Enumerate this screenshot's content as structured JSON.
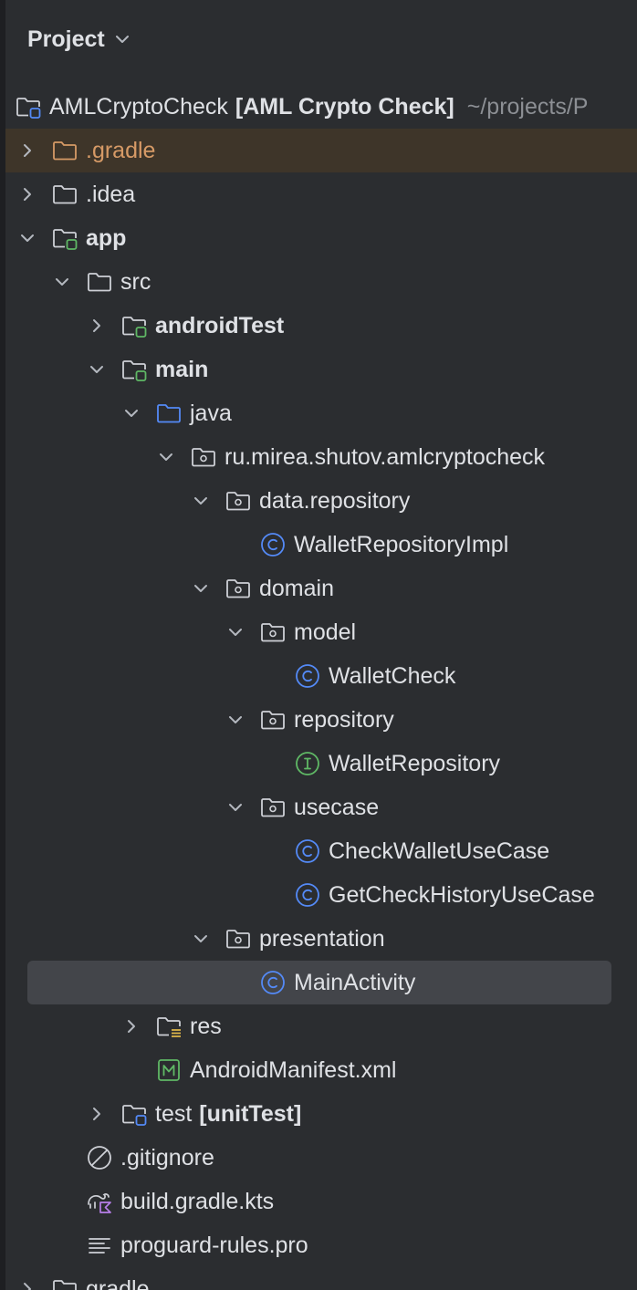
{
  "header": {
    "title": "Project"
  },
  "tree": [
    {
      "label": "AMLCryptoCheck",
      "extra": "[AML Crypto Check]",
      "path": "~/projects/P",
      "icon": "module-folder-icon",
      "state": "none"
    },
    {
      "label": ".gradle",
      "icon": "folder-icon",
      "state": "collapsed"
    },
    {
      "label": ".idea",
      "icon": "folder-icon",
      "state": "collapsed"
    },
    {
      "label": "app",
      "icon": "module-folder-icon",
      "state": "expanded"
    },
    {
      "label": "src",
      "icon": "folder-icon",
      "state": "expanded"
    },
    {
      "label": "androidTest",
      "icon": "module-folder-icon",
      "state": "collapsed"
    },
    {
      "label": "main",
      "icon": "module-folder-icon",
      "state": "expanded"
    },
    {
      "label": "java",
      "icon": "source-folder-icon",
      "state": "expanded"
    },
    {
      "label": "ru.mirea.shutov.amlcryptocheck",
      "icon": "package-icon",
      "state": "expanded"
    },
    {
      "label": "data.repository",
      "icon": "package-icon",
      "state": "expanded"
    },
    {
      "label": "WalletRepositoryImpl",
      "icon": "class-icon",
      "state": "none"
    },
    {
      "label": "domain",
      "icon": "package-icon",
      "state": "expanded"
    },
    {
      "label": "model",
      "icon": "package-icon",
      "state": "expanded"
    },
    {
      "label": "WalletCheck",
      "icon": "class-icon",
      "state": "none"
    },
    {
      "label": "repository",
      "icon": "package-icon",
      "state": "expanded"
    },
    {
      "label": "WalletRepository",
      "icon": "interface-icon",
      "state": "none"
    },
    {
      "label": "usecase",
      "icon": "package-icon",
      "state": "expanded"
    },
    {
      "label": "CheckWalletUseCase",
      "icon": "class-icon",
      "state": "none"
    },
    {
      "label": "GetCheckHistoryUseCase",
      "icon": "class-icon",
      "state": "none"
    },
    {
      "label": "presentation",
      "icon": "package-icon",
      "state": "expanded"
    },
    {
      "label": "MainActivity",
      "icon": "class-icon",
      "state": "none"
    },
    {
      "label": "res",
      "icon": "resource-folder-icon",
      "state": "collapsed"
    },
    {
      "label": "AndroidManifest.xml",
      "icon": "manifest-icon",
      "state": "none"
    },
    {
      "label": "test",
      "extra": "[unitTest]",
      "icon": "test-module-folder-icon",
      "state": "collapsed"
    },
    {
      "label": ".gitignore",
      "icon": "ignore-file-icon",
      "state": "none"
    },
    {
      "label": "build.gradle.kts",
      "icon": "gradle-kts-icon",
      "state": "none"
    },
    {
      "label": "proguard-rules.pro",
      "icon": "text-file-icon",
      "state": "none"
    },
    {
      "label": "gradle",
      "icon": "folder-icon",
      "state": "collapsed"
    }
  ],
  "colors": {
    "background": "#2b2d30",
    "selection": "#43454a",
    "excluded_highlight": "#3e3529",
    "excluded_text": "#d69a66",
    "class_blue": "#548af7",
    "interface_green": "#5fb865",
    "module_green": "#5fb865"
  }
}
